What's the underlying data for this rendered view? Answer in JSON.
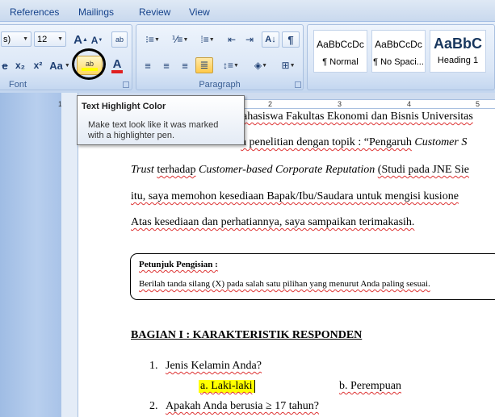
{
  "tabs": [
    "References",
    "Mailings",
    "Review",
    "View"
  ],
  "font_group": {
    "label": "Font",
    "font_size": "12",
    "grow_label": "A",
    "shrink_label": "A",
    "clear_label": "ab",
    "strike_label": "e",
    "subscript_label": "x₂",
    "superscript_label": "x²",
    "case_label": "Aa",
    "highlight_label": "ab",
    "fontcolor_label": "A",
    "highlight_color": "#ffff00",
    "fontcolor_color": "#e02020"
  },
  "paragraph_group": {
    "label": "Paragraph"
  },
  "styles": [
    {
      "sample": "AaBbCcDc",
      "name": "¶ Normal"
    },
    {
      "sample": "AaBbCcDc",
      "name": "¶ No Spaci..."
    },
    {
      "sample": "AaBbC",
      "name": "Heading 1"
    }
  ],
  "ruler": {
    "numbers": [
      "1",
      "2",
      "3",
      "4",
      "5"
    ]
  },
  "tooltip": {
    "title": "Text Highlight Color",
    "line1": "Make text look like it was marked",
    "line2": "with a highlighter pen."
  },
  "document": {
    "line1": "ahasiswa Fakultas Ekonomi dan Bisnis Universitas",
    "line2_a": "n penelitian dengan topik : “Pengaruh",
    "line2_b": "Customer S",
    "line3_a": "Trust",
    "line3_b": "terhadap",
    "line3_c": "Customer-based Corporate Reputation",
    "line3_d": "(Studi pada JNE Sie",
    "line4": "itu, saya memohon kesediaan Bapak/Ibu/Saudara untuk mengisi kusione",
    "line5": "Atas kesediaan dan perhatiannya, saya sampaikan terimakasih.",
    "petunjuk_title": "Petunjuk Pengisian :",
    "petunjuk_text": "Berilah tanda silang (X) pada salah satu pilihan yang menurut Anda paling sesuai.",
    "section_heading": "BAGIAN I : KARAKTERISTIK  RESPONDEN",
    "q1_num": "1.",
    "q1_text": "Jenis Kelamin Anda?",
    "q1_opt_a": "a. Laki-laki",
    "q1_opt_b": "b. Perempuan",
    "q2_num": "2.",
    "q2_text": "Apakah Anda berusia ≥ 17 tahun?"
  }
}
